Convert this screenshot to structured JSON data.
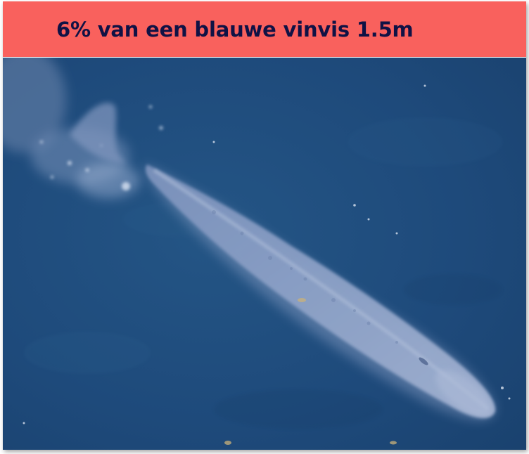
{
  "banner": {
    "title": "6% van een blauwe vinvis 1.5m"
  },
  "photo": {
    "subject": "blue-whale",
    "icon": "whale-aerial-photo"
  },
  "colors": {
    "banner_background": "#f9615d",
    "banner_text": "#101245",
    "ocean": "#1e4a7c",
    "whale": "#93a6c9"
  }
}
